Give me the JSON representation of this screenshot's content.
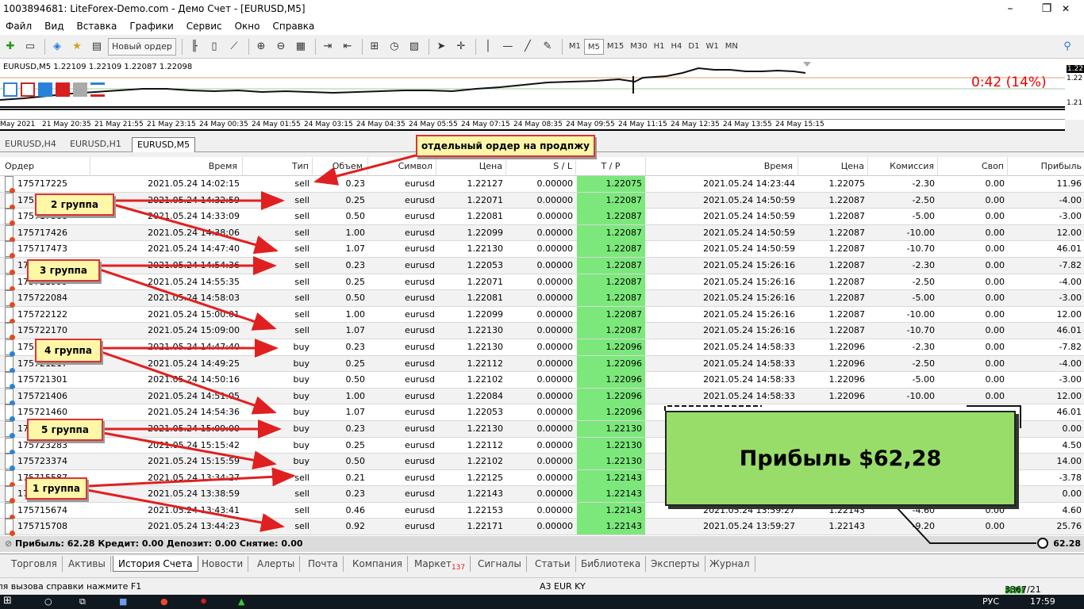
{
  "window": {
    "title": "1003894681: LiteForex-Demo.com - Демо Счет - [EURUSD,M5]",
    "minimize": "–",
    "restore": "❐",
    "close": "✕"
  },
  "menu": [
    "Файл",
    "Вид",
    "Вставка",
    "Графики",
    "Сервис",
    "Окно",
    "Справка"
  ],
  "toolbar": {
    "new_order": "Новый ордер",
    "timeframes": [
      "M1",
      "M5",
      "M15",
      "M30",
      "H1",
      "H4",
      "D1",
      "W1",
      "MN"
    ],
    "active_timeframe": "M5"
  },
  "chart": {
    "info": "EURUSD,M5  1.22109 1.22109 1.22087 1.22098",
    "timer": "0:42 (14%)",
    "price_labels": [
      "1.22",
      "1.22",
      "1.21"
    ],
    "time_labels": [
      "May 2021",
      "21 May 20:35",
      "21 May 21:55",
      "21 May 23:15",
      "24 May 00:35",
      "24 May 01:55",
      "24 May 03:15",
      "24 May 04:35",
      "24 May 05:55",
      "24 May 07:15",
      "24 May 08:35",
      "24 May 09:55",
      "24 May 11:15",
      "24 May 12:35",
      "24 May 13:55",
      "24 May 15:15"
    ]
  },
  "chart_tabs": [
    "EURUSD,H4",
    "EURUSD,H1",
    "EURUSD,M5"
  ],
  "active_chart_tab": "EURUSD,M5",
  "table": {
    "headers": [
      "Ордер",
      "Время",
      "Тип",
      "Объем",
      "Символ",
      "Цена",
      "S / L",
      "T / P",
      "Время",
      "Цена",
      "Комиссия",
      "Своп",
      "Прибыль"
    ],
    "rows": [
      {
        "order": "175717225",
        "open": "2021.05.24 14:02:15",
        "type": "sell",
        "vol": "0.23",
        "sym": "eurusd",
        "price": "1.22127",
        "sl": "0.00000",
        "tp": "1.22075",
        "close": "2021.05.24 14:23:44",
        "cprice": "1.22075",
        "comm": "-2.30",
        "swap": "0.00",
        "profit": "11.96"
      },
      {
        "order": "175717358",
        "open": "2021.05.24 14:32:59",
        "type": "sell",
        "vol": "0.25",
        "sym": "eurusd",
        "price": "1.22071",
        "sl": "0.00000",
        "tp": "1.22087",
        "close": "2021.05.24 14:50:59",
        "cprice": "1.22087",
        "comm": "-2.50",
        "swap": "0.00",
        "profit": "-4.00"
      },
      {
        "order": "175717388",
        "open": "2021.05.24 14:33:09",
        "type": "sell",
        "vol": "0.50",
        "sym": "eurusd",
        "price": "1.22081",
        "sl": "0.00000",
        "tp": "1.22087",
        "close": "2021.05.24 14:50:59",
        "cprice": "1.22087",
        "comm": "-5.00",
        "swap": "0.00",
        "profit": "-3.00"
      },
      {
        "order": "175717426",
        "open": "2021.05.24 14:38:06",
        "type": "sell",
        "vol": "1.00",
        "sym": "eurusd",
        "price": "1.22099",
        "sl": "0.00000",
        "tp": "1.22087",
        "close": "2021.05.24 14:50:59",
        "cprice": "1.22087",
        "comm": "-10.00",
        "swap": "0.00",
        "profit": "12.00"
      },
      {
        "order": "175717473",
        "open": "2021.05.24 14:47:40",
        "type": "sell",
        "vol": "1.07",
        "sym": "eurusd",
        "price": "1.22130",
        "sl": "0.00000",
        "tp": "1.22087",
        "close": "2021.05.24 14:50:59",
        "cprice": "1.22087",
        "comm": "-10.70",
        "swap": "0.00",
        "profit": "46.01"
      },
      {
        "order": "175721987",
        "open": "2021.05.24 14:54:36",
        "type": "sell",
        "vol": "0.23",
        "sym": "eurusd",
        "price": "1.22053",
        "sl": "0.00000",
        "tp": "1.22087",
        "close": "2021.05.24 15:26:16",
        "cprice": "1.22087",
        "comm": "-2.30",
        "swap": "0.00",
        "profit": "-7.82"
      },
      {
        "order": "175721999",
        "open": "2021.05.24 14:55:35",
        "type": "sell",
        "vol": "0.25",
        "sym": "eurusd",
        "price": "1.22071",
        "sl": "0.00000",
        "tp": "1.22087",
        "close": "2021.05.24 15:26:16",
        "cprice": "1.22087",
        "comm": "-2.50",
        "swap": "0.00",
        "profit": "-4.00"
      },
      {
        "order": "175722084",
        "open": "2021.05.24 14:58:03",
        "type": "sell",
        "vol": "0.50",
        "sym": "eurusd",
        "price": "1.22081",
        "sl": "0.00000",
        "tp": "1.22087",
        "close": "2021.05.24 15:26:16",
        "cprice": "1.22087",
        "comm": "-5.00",
        "swap": "0.00",
        "profit": "-3.00"
      },
      {
        "order": "175722122",
        "open": "2021.05.24 15:00:01",
        "type": "sell",
        "vol": "1.00",
        "sym": "eurusd",
        "price": "1.22099",
        "sl": "0.00000",
        "tp": "1.22087",
        "close": "2021.05.24 15:26:16",
        "cprice": "1.22087",
        "comm": "-10.00",
        "swap": "0.00",
        "profit": "12.00"
      },
      {
        "order": "175722170",
        "open": "2021.05.24 15:09:00",
        "type": "sell",
        "vol": "1.07",
        "sym": "eurusd",
        "price": "1.22130",
        "sl": "0.00000",
        "tp": "1.22087",
        "close": "2021.05.24 15:26:16",
        "cprice": "1.22087",
        "comm": "-10.70",
        "swap": "0.00",
        "profit": "46.01"
      },
      {
        "order": "175721191",
        "open": "2021.05.24 14:47:40",
        "type": "buy",
        "vol": "0.23",
        "sym": "eurusd",
        "price": "1.22130",
        "sl": "0.00000",
        "tp": "1.22096",
        "close": "2021.05.24 14:58:33",
        "cprice": "1.22096",
        "comm": "-2.30",
        "swap": "0.00",
        "profit": "-7.82"
      },
      {
        "order": "175721217",
        "open": "2021.05.24 14:49:25",
        "type": "buy",
        "vol": "0.25",
        "sym": "eurusd",
        "price": "1.22112",
        "sl": "0.00000",
        "tp": "1.22096",
        "close": "2021.05.24 14:58:33",
        "cprice": "1.22096",
        "comm": "-2.50",
        "swap": "0.00",
        "profit": "-4.00"
      },
      {
        "order": "175721301",
        "open": "2021.05.24 14:50:16",
        "type": "buy",
        "vol": "0.50",
        "sym": "eurusd",
        "price": "1.22102",
        "sl": "0.00000",
        "tp": "1.22096",
        "close": "2021.05.24 14:58:33",
        "cprice": "1.22096",
        "comm": "-5.00",
        "swap": "0.00",
        "profit": "-3.00"
      },
      {
        "order": "175721406",
        "open": "2021.05.24 14:51:05",
        "type": "buy",
        "vol": "1.00",
        "sym": "eurusd",
        "price": "1.22084",
        "sl": "0.00000",
        "tp": "1.22096",
        "close": "2021.05.24 14:58:33",
        "cprice": "1.22096",
        "comm": "-10.00",
        "swap": "0.00",
        "profit": "12.00"
      },
      {
        "order": "175721460",
        "open": "2021.05.24 14:54:36",
        "type": "buy",
        "vol": "1.07",
        "sym": "eurusd",
        "price": "1.22053",
        "sl": "0.00000",
        "tp": "1.22096",
        "close": "",
        "cprice": "",
        "comm": "",
        "swap": "",
        "profit": "46.01"
      },
      {
        "order": "175723180",
        "open": "2021.05.24 15:09:00",
        "type": "buy",
        "vol": "0.23",
        "sym": "eurusd",
        "price": "1.22130",
        "sl": "0.00000",
        "tp": "1.22130",
        "close": "",
        "cprice": "",
        "comm": "",
        "swap": "",
        "profit": "0.00"
      },
      {
        "order": "175723283",
        "open": "2021.05.24 15:15:42",
        "type": "buy",
        "vol": "0.25",
        "sym": "eurusd",
        "price": "1.22112",
        "sl": "0.00000",
        "tp": "1.22130",
        "close": "",
        "cprice": "",
        "comm": "",
        "swap": "",
        "profit": "4.50"
      },
      {
        "order": "175723374",
        "open": "2021.05.24 15:15:59",
        "type": "buy",
        "vol": "0.50",
        "sym": "eurusd",
        "price": "1.22102",
        "sl": "0.00000",
        "tp": "1.22130",
        "close": "",
        "cprice": "",
        "comm": "",
        "swap": "",
        "profit": "14.00"
      },
      {
        "order": "175715587",
        "open": "2021.05.24 13:34:27",
        "type": "sell",
        "vol": "0.21",
        "sym": "eurusd",
        "price": "1.22125",
        "sl": "0.00000",
        "tp": "1.22143",
        "close": "",
        "cprice": "",
        "comm": "",
        "swap": "",
        "profit": "-3.78"
      },
      {
        "order": "175715627",
        "open": "2021.05.24 13:38:59",
        "type": "sell",
        "vol": "0.23",
        "sym": "eurusd",
        "price": "1.22143",
        "sl": "0.00000",
        "tp": "1.22143",
        "close": "",
        "cprice": "",
        "comm": "",
        "swap": "",
        "profit": "0.00"
      },
      {
        "order": "175715674",
        "open": "2021.05.24 13:43:41",
        "type": "sell",
        "vol": "0.46",
        "sym": "eurusd",
        "price": "1.22153",
        "sl": "0.00000",
        "tp": "1.22143",
        "close": "2021.05.24 13:59:27",
        "cprice": "1.22143",
        "comm": "-4.60",
        "swap": "0.00",
        "profit": "4.60"
      },
      {
        "order": "175715708",
        "open": "2021.05.24 13:44:23",
        "type": "sell",
        "vol": "0.92",
        "sym": "eurusd",
        "price": "1.22171",
        "sl": "0.00000",
        "tp": "1.22143",
        "close": "2021.05.24 13:59:27",
        "cprice": "1.22143",
        "comm": "-9.20",
        "swap": "0.00",
        "profit": "25.76"
      }
    ],
    "summary": "Прибыль: 62.28  Кредит: 0.00  Депозит: 0.00  Снятие: 0.00",
    "summary_total": "62.28"
  },
  "annotations": {
    "single_order": "отдельный ордер на продпжу",
    "group2": "2 группа",
    "group3": "3 группа",
    "group4": "4 группа",
    "group5": "5 группа",
    "group1": "1 группа",
    "profit": "Прибыль $62,28"
  },
  "bottom_tabs": [
    "Торговля",
    "Активы",
    "История Счета",
    "Новости",
    "Алерты",
    "Почта",
    "Компания",
    "Маркет",
    "Сигналы",
    "Статьи",
    "Библиотека",
    "Эксперты",
    "Журнал"
  ],
  "market_badge": "137",
  "active_bottom_tab": "История Счета",
  "status": {
    "help": "Для вызова справки нажмите F1",
    "profile": "A3 EUR KY",
    "traffic": "3367/21 kb"
  },
  "taskbar": {
    "clock": "17:59",
    "lang": "РУС"
  }
}
